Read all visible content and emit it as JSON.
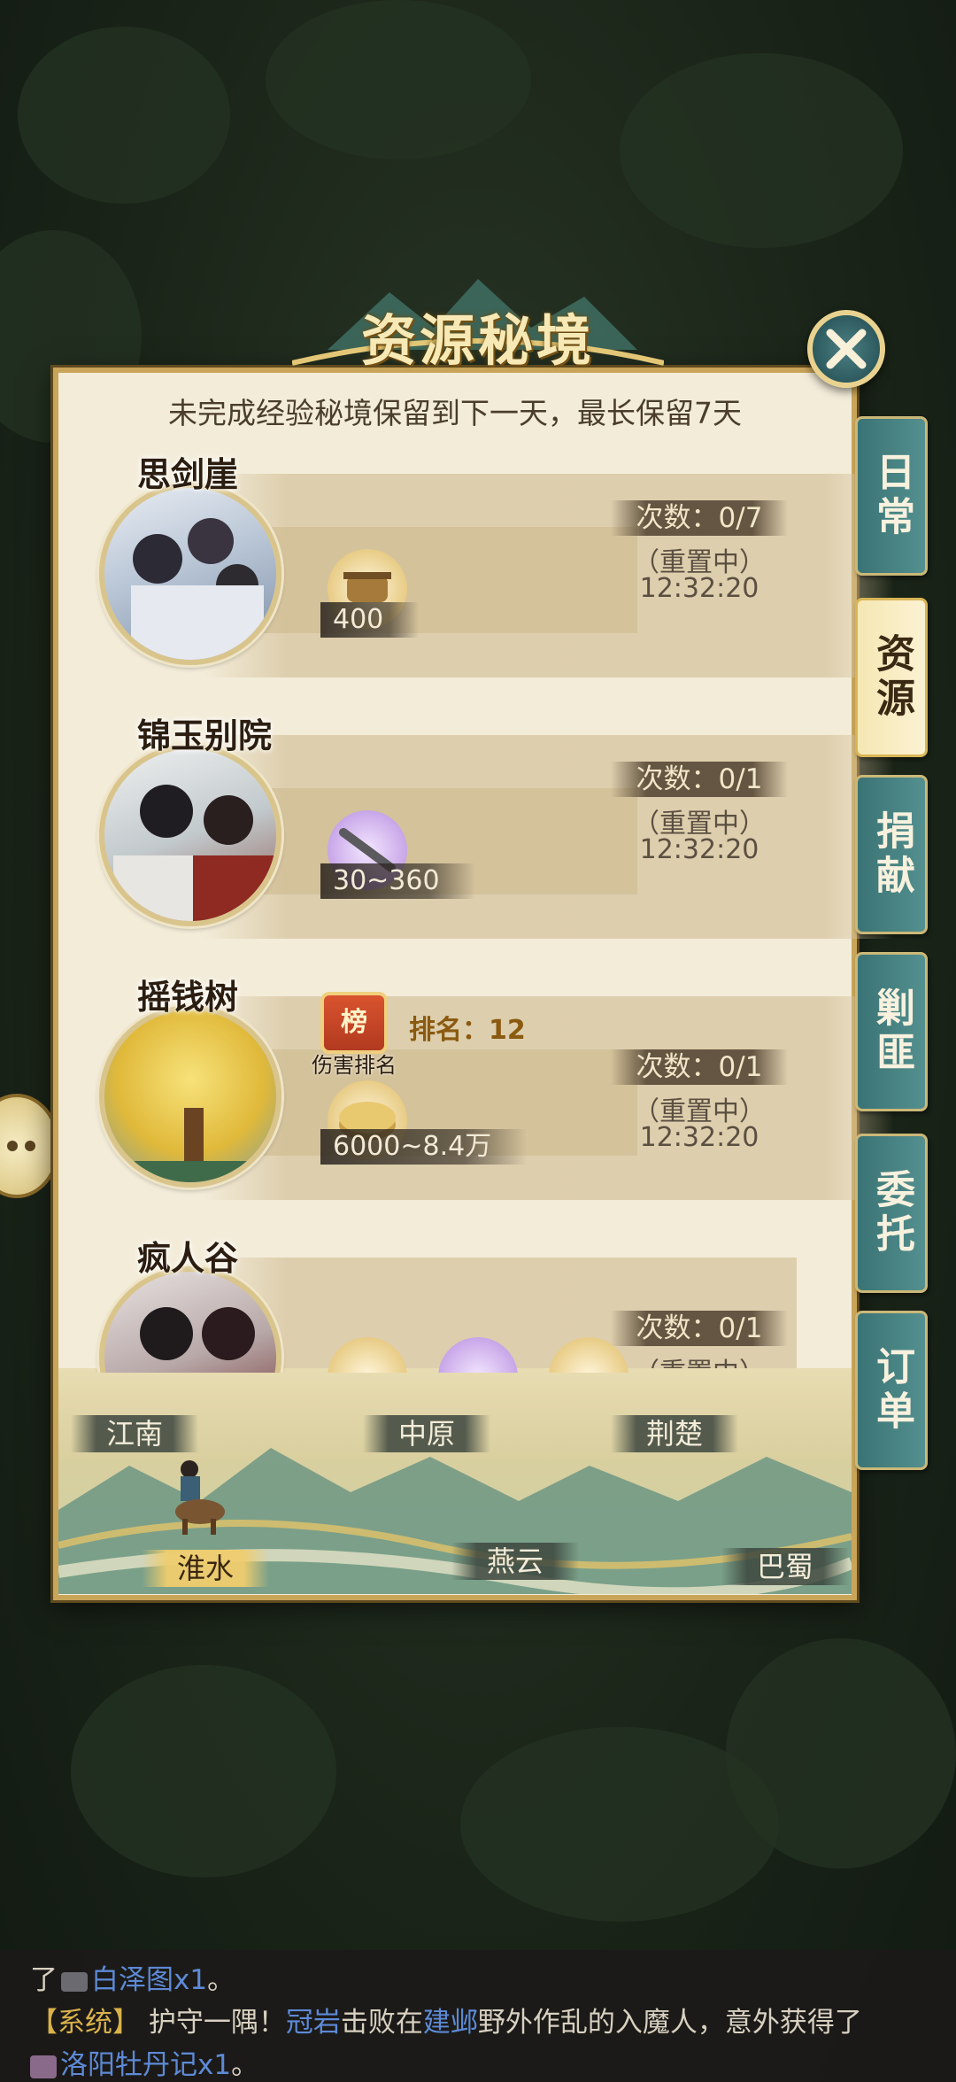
{
  "title": "资源秘境",
  "notice": "未完成经验秘境保留到下一天，最长保留7天",
  "cards": [
    {
      "name": "思剑崖",
      "reward": "400",
      "count_label": "次数：0/7",
      "status": "（重置中）",
      "timer": "12:32:20"
    },
    {
      "name": "锦玉别院",
      "reward": "30~360",
      "count_label": "次数：0/1",
      "status": "（重置中）",
      "timer": "12:32:20"
    },
    {
      "name": "摇钱树",
      "rank_label": "排名：12",
      "rank_caption": "伤害排名",
      "rank_icon_text": "榜",
      "reward": "6000~8.4万",
      "count_label": "次数：0/1",
      "status": "（重置中）",
      "timer": "12:32:20"
    },
    {
      "name": "疯人谷",
      "count_label": "次数：0/1",
      "status": "（重置中）"
    }
  ],
  "side_tabs": [
    {
      "label": "日常",
      "active": false
    },
    {
      "label": "资源",
      "active": true
    },
    {
      "label": "捐献",
      "active": false
    },
    {
      "label": "剿匪",
      "active": false
    },
    {
      "label": "委托",
      "active": false
    },
    {
      "label": "订单",
      "active": false
    }
  ],
  "regions": {
    "jiangnan": "江南",
    "zhongyuan": "中原",
    "jingchu": "荆楚",
    "huaishui": "淮水",
    "yanyun": "燕云",
    "bashu": "巴蜀"
  },
  "chat": {
    "line1_prefix": "了",
    "line1_item": "白泽图x1",
    "line1_suffix": "。",
    "line2_tag": "【系统】",
    "line2_a": "护守一隅！",
    "line2_name": "冠岩",
    "line2_b": "击败在",
    "line2_place": "建邺",
    "line2_c": "野外作乱的入魔人，意外获得了",
    "line3_item": "洛阳牡丹记x1",
    "line3_suffix": "。"
  },
  "icons": {
    "close": "close-x-icon",
    "reward_scroll": "scroll-icon",
    "reward_sword": "sword-icon",
    "reward_coin": "coin-icon",
    "rank": "ranking-scroll-icon",
    "chat": "chat-bubble-icon"
  },
  "colors": {
    "panel_bg": "#f3ecd9",
    "tab_teal": "#3a7375",
    "tab_active": "#f5e7b3",
    "gold": "#c9a55a"
  }
}
